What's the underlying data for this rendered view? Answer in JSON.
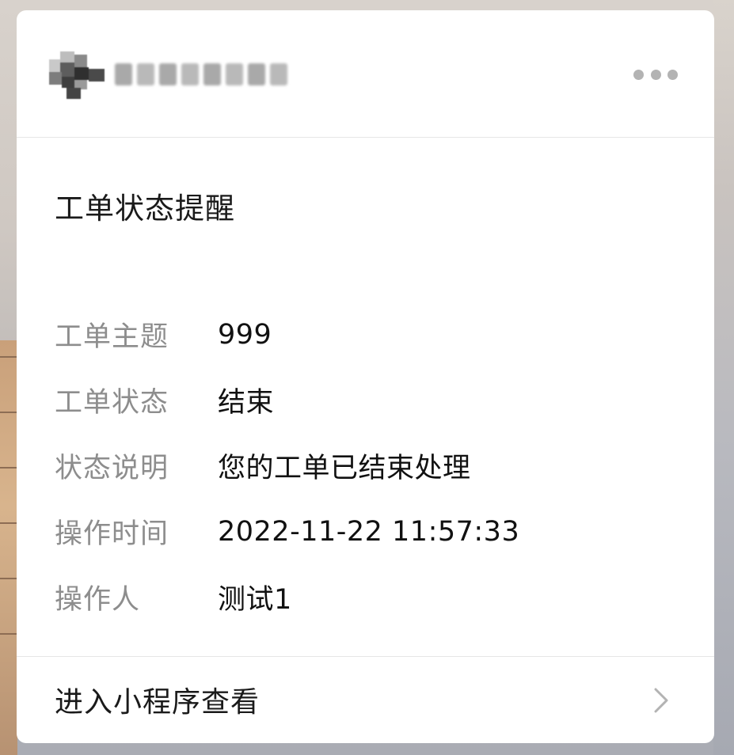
{
  "header": {
    "account_name": "",
    "more_icon": "more-horizontal-icon"
  },
  "card": {
    "title": "工单状态提醒"
  },
  "fields": [
    {
      "label": "工单主题",
      "value": "999"
    },
    {
      "label": "工单状态",
      "value": "结束"
    },
    {
      "label": "状态说明",
      "value": "您的工单已结束处理"
    },
    {
      "label": "操作时间",
      "value": "2022-11-22 11:57:33"
    },
    {
      "label": "操作人",
      "value": "测试1"
    }
  ],
  "footer": {
    "label": "进入小程序查看",
    "icon": "chevron-right-icon"
  },
  "colors": {
    "card_bg": "#ffffff",
    "label_gray": "#8d8d8d",
    "text_dark": "#111111",
    "divider": "#e6e6e6",
    "icon_gray": "#b3b3b3"
  }
}
